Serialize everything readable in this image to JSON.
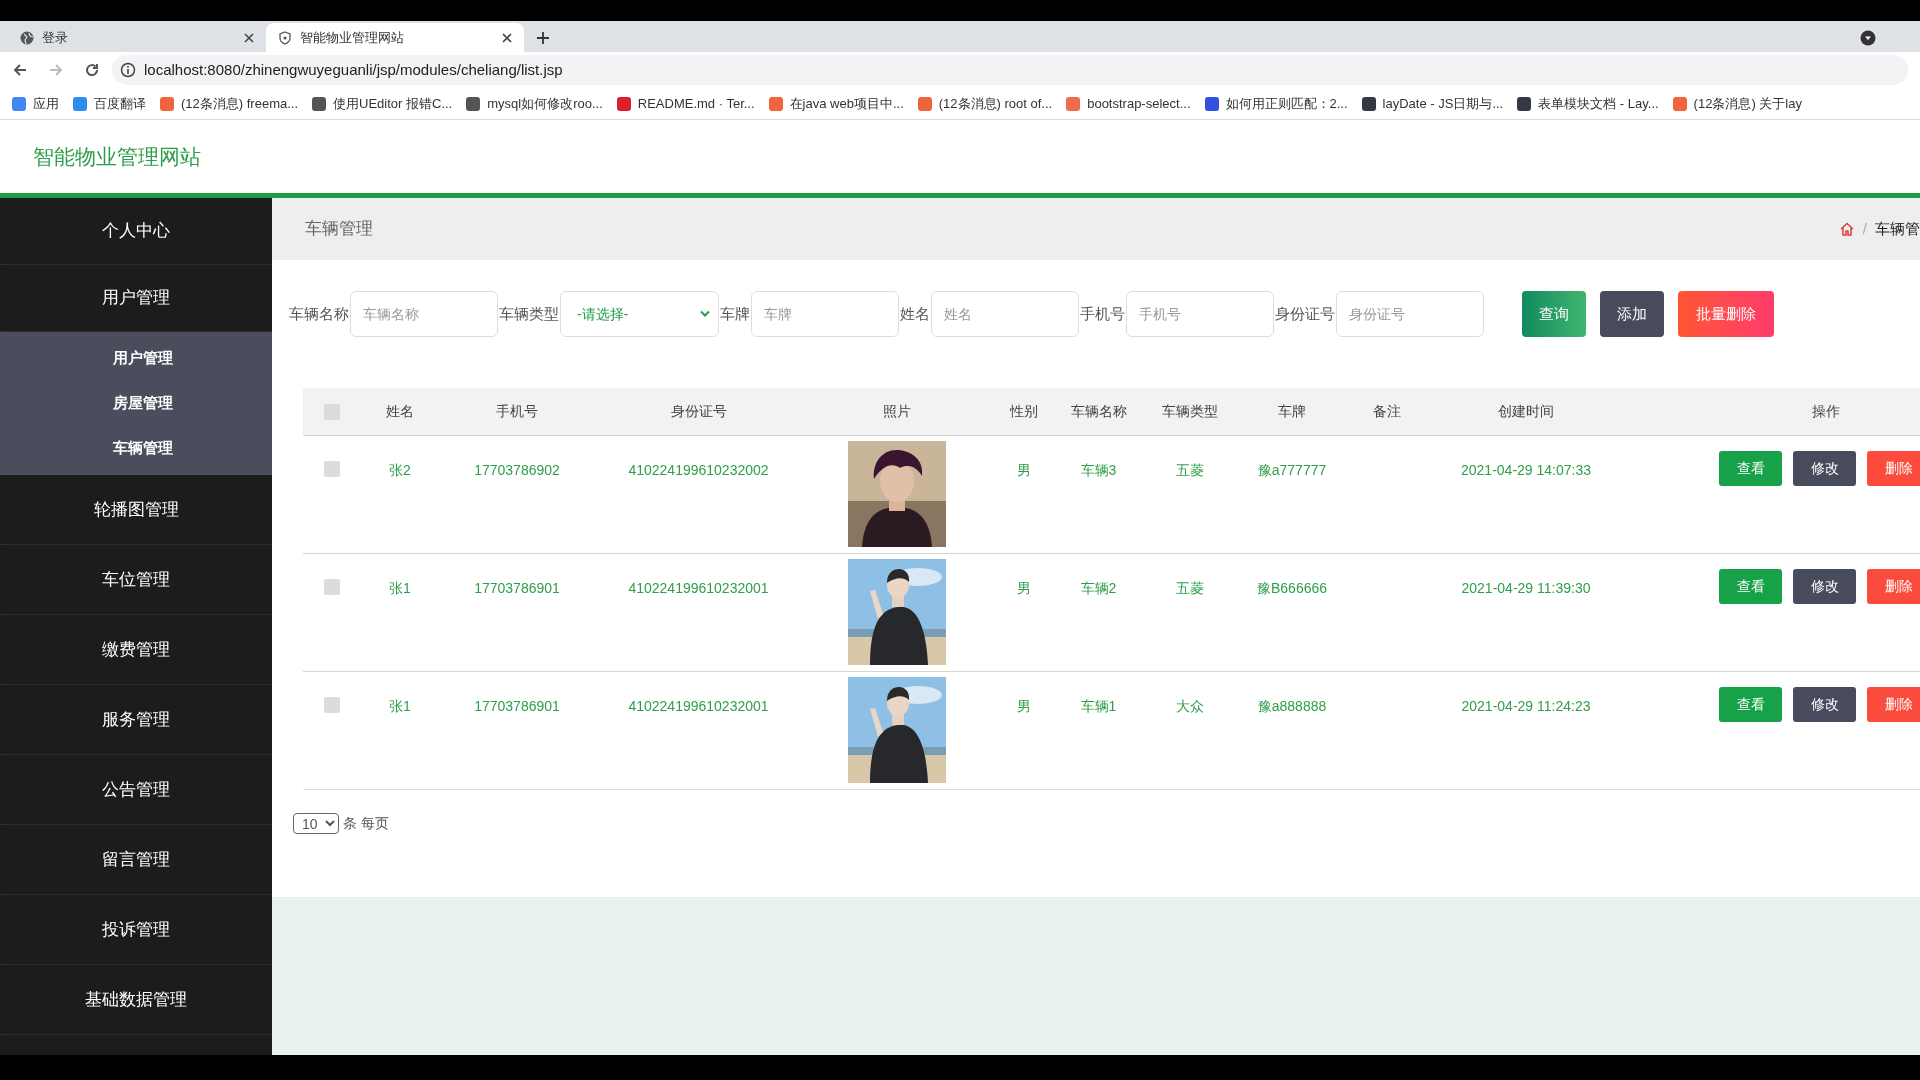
{
  "browser": {
    "tabs": [
      {
        "title": "登录",
        "selected": false
      },
      {
        "title": "智能物业管理网站",
        "selected": true
      }
    ],
    "url": "localhost:8080/zhinengwuyeguanli/jsp/modules/cheliang/list.jsp",
    "bookmarks": [
      {
        "label": "应用",
        "color": "#4285f4"
      },
      {
        "label": "百度翻译",
        "color": "#2d8cf0"
      },
      {
        "label": "(12条消息) freema...",
        "color": "#f0643c"
      },
      {
        "label": "使用UEditor 报错C...",
        "color": "#555555"
      },
      {
        "label": "mysql如何修改roo...",
        "color": "#555555"
      },
      {
        "label": "README.md · Ter...",
        "color": "#d9202b"
      },
      {
        "label": "在java web项目中...",
        "color": "#f0643c"
      },
      {
        "label": "(12条消息) root of...",
        "color": "#f0643c"
      },
      {
        "label": "bootstrap-select...",
        "color": "#ef6c4a"
      },
      {
        "label": "如何用正则匹配：2...",
        "color": "#3050e0"
      },
      {
        "label": "layDate - JS日期与...",
        "color": "#333844"
      },
      {
        "label": "表单模块文档 - Lay...",
        "color": "#333844"
      },
      {
        "label": "(12条消息) 关于lay",
        "color": "#f0643c"
      }
    ]
  },
  "app": {
    "title": "智能物业管理网站"
  },
  "sidebar": {
    "items": [
      {
        "label": "个人中心"
      },
      {
        "label": "用户管理",
        "children": [
          {
            "label": "用户管理"
          },
          {
            "label": "房屋管理"
          },
          {
            "label": "车辆管理"
          }
        ]
      },
      {
        "label": "轮播图管理"
      },
      {
        "label": "车位管理"
      },
      {
        "label": "缴费管理"
      },
      {
        "label": "服务管理"
      },
      {
        "label": "公告管理"
      },
      {
        "label": "留言管理"
      },
      {
        "label": "投诉管理"
      },
      {
        "label": "基础数据管理"
      }
    ]
  },
  "page": {
    "title": "车辆管理",
    "separator": "/",
    "breadcrumb": "车辆管"
  },
  "filters": [
    {
      "label": "车辆名称",
      "kind": "input",
      "placeholder": "车辆名称"
    },
    {
      "label": "车辆类型",
      "kind": "select",
      "value": "-请选择-"
    },
    {
      "label": "车牌",
      "kind": "input",
      "placeholder": "车牌"
    },
    {
      "label": "姓名",
      "kind": "input",
      "placeholder": "姓名"
    },
    {
      "label": "手机号",
      "kind": "input",
      "placeholder": "手机号"
    },
    {
      "label": "身份证号",
      "kind": "input",
      "placeholder": "身份证号"
    }
  ],
  "actions": [
    {
      "label": "查询",
      "kind": "query"
    },
    {
      "label": "添加",
      "kind": "add"
    },
    {
      "label": "批量删除",
      "kind": "delete"
    }
  ],
  "table": {
    "all_checked": false,
    "columns": [
      "姓名",
      "手机号",
      "身份证号",
      "照片",
      "性别",
      "车辆名称",
      "车辆类型",
      "车牌",
      "备注",
      "创建时间",
      "操作"
    ],
    "rows": [
      {
        "checked": false,
        "name": "张2",
        "phone": "17703786902",
        "id_number": "410224199610232002",
        "gender": "男",
        "vehicle_name": "车辆3",
        "vehicle_type": "五菱",
        "plate": "豫a777777",
        "created": "2021-04-29 14:07:33",
        "buttons": [
          {
            "label": "查看",
            "kind": "view"
          },
          {
            "label": "修改",
            "kind": "edit"
          },
          {
            "label": "删除",
            "kind": "delete"
          }
        ]
      },
      {
        "checked": false,
        "name": "张1",
        "phone": "17703786901",
        "id_number": "410224199610232001",
        "gender": "男",
        "vehicle_name": "车辆2",
        "vehicle_type": "五菱",
        "plate": "豫B666666",
        "created": "2021-04-29 11:39:30",
        "buttons": [
          {
            "label": "查看",
            "kind": "view"
          },
          {
            "label": "修改",
            "kind": "edit"
          },
          {
            "label": "删除",
            "kind": "delete"
          }
        ]
      },
      {
        "checked": false,
        "name": "张1",
        "phone": "17703786901",
        "id_number": "410224199610232001",
        "gender": "男",
        "vehicle_name": "车辆1",
        "vehicle_type": "大众",
        "plate": "豫a888888",
        "created": "2021-04-29 11:24:23",
        "buttons": [
          {
            "label": "查看",
            "kind": "view"
          },
          {
            "label": "修改",
            "kind": "edit"
          },
          {
            "label": "删除",
            "kind": "delete"
          }
        ]
      }
    ]
  },
  "pagination": {
    "page_size": "10",
    "label": "条 每页"
  }
}
